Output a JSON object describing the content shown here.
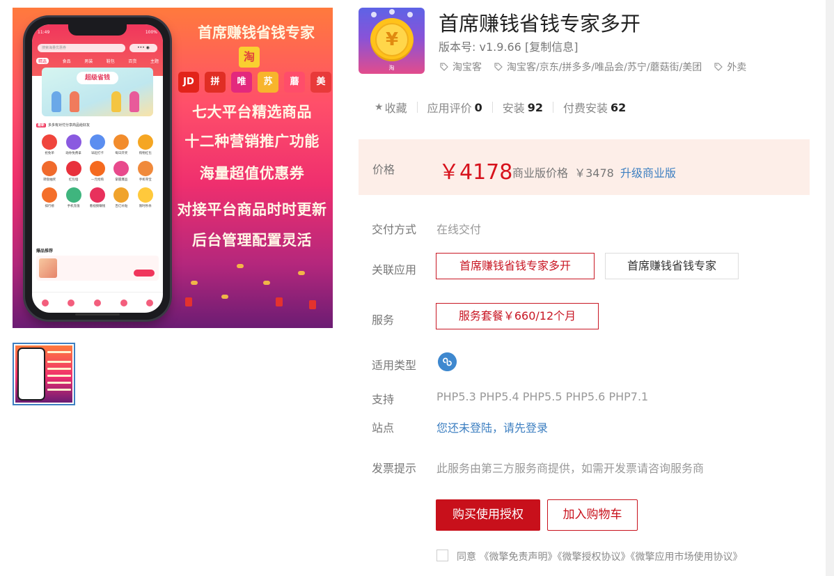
{
  "gallery": {
    "phone_status_time": "11:49",
    "phone_status_battery": "100%",
    "phone_search_placeholder": "搜索海量优惠券",
    "phone_tabs": [
      "精选",
      "食品",
      "男装",
      "鞋包",
      "百货",
      "主题"
    ],
    "phone_banner_title": "超级省钱",
    "phone_notice_tag": "最新",
    "phone_notice_text": "多多有对付分享商品给好友",
    "phone_grid_items": [
      {
        "label": "抢免单",
        "color": "#f0453c"
      },
      {
        "label": "助你免费拿",
        "color": "#8a5ae0"
      },
      {
        "label": "早起打卡",
        "color": "#5b8ef0"
      },
      {
        "label": "每日开奖",
        "color": "#f28c2c"
      },
      {
        "label": "购物红包",
        "color": "#f5a623"
      },
      {
        "label": "转盘抽奖",
        "color": "#f06a2c"
      },
      {
        "label": "红包墙",
        "color": "#e8313c"
      },
      {
        "label": "一元抢购",
        "color": "#f56a1f"
      },
      {
        "label": "掌握爆品",
        "color": "#e84a8c"
      },
      {
        "label": "手机夺宝",
        "color": "#f08a3c"
      },
      {
        "label": "排行榜",
        "color": "#f46f2a"
      },
      {
        "label": "手机充值",
        "color": "#3fb57e"
      },
      {
        "label": "看视频赚钱",
        "color": "#e8315c"
      },
      {
        "label": "百亿补贴",
        "color": "#f0a32c"
      },
      {
        "label": "限时秒杀",
        "color": "#ffc93c"
      }
    ],
    "phone_hot_title": "爆品推荐",
    "hero_title": "首席赚钱省钱专家",
    "tao_badge": "淘",
    "platform_logos": [
      {
        "text": "JD",
        "color": "#e2231a"
      },
      {
        "text": "拼",
        "color": "#e02e24"
      },
      {
        "text": "唯",
        "color": "#e3297d"
      },
      {
        "text": "苏",
        "color": "#f7b52c"
      },
      {
        "text": "蘑",
        "color": "#ff4d6a"
      },
      {
        "text": "美",
        "color": "#e83a3a"
      }
    ],
    "features": [
      "七大平台精选商品",
      "十二种营销推广功能",
      "海量超值优惠券",
      "对接平台商品时时更新",
      "后台管理配置灵活"
    ]
  },
  "app": {
    "title": "首席赚钱省钱专家多开",
    "icon_symbol": "¥",
    "icon_caption": "淘",
    "version_label": "版本号:",
    "version": "v1.9.66",
    "copy_info": "[复制信息]",
    "tags": [
      "淘宝客",
      "淘宝客/京东/拼多多/唯品会/苏宁/蘑菇街/美团",
      "外卖"
    ]
  },
  "stats": {
    "favorite_label": "收藏",
    "reviews_label": "应用评价",
    "reviews_value": "0",
    "installs_label": "安装",
    "installs_value": "92",
    "paid_installs_label": "付费安装",
    "paid_installs_value": "62"
  },
  "price": {
    "label": "价格",
    "main": "￥4178",
    "business_label": "商业版价格",
    "business_value": "￥3478",
    "upgrade_link": "升级商业版"
  },
  "details": {
    "delivery_label": "交付方式",
    "delivery_value": "在线交付",
    "related_label": "关联应用",
    "related_apps": [
      "首席赚钱省钱专家多开",
      "首席赚钱省钱专家"
    ],
    "service_label": "服务",
    "service_package": "服务套餐￥660/12个月",
    "type_label": "适用类型",
    "support_label": "支持",
    "support_value": "PHP5.3 PHP5.4 PHP5.5 PHP5.6 PHP7.1",
    "site_label": "站点",
    "site_value": "您还未登陆，请先登录",
    "invoice_label": "发票提示",
    "invoice_value": "此服务由第三方服务商提供，如需开发票请咨询服务商"
  },
  "actions": {
    "buy_label": "购买使用授权",
    "cart_label": "加入购物车"
  },
  "agreement": {
    "prefix": "同意",
    "links": [
      "《微擎免责声明》",
      "《微擎授权协议》",
      "《微擎应用市场使用协议》"
    ]
  },
  "colors": {
    "accent_red": "#c8101b",
    "price_red": "#d7121c",
    "link_blue": "#3d7fc1",
    "price_bg": "#fdeee8"
  }
}
